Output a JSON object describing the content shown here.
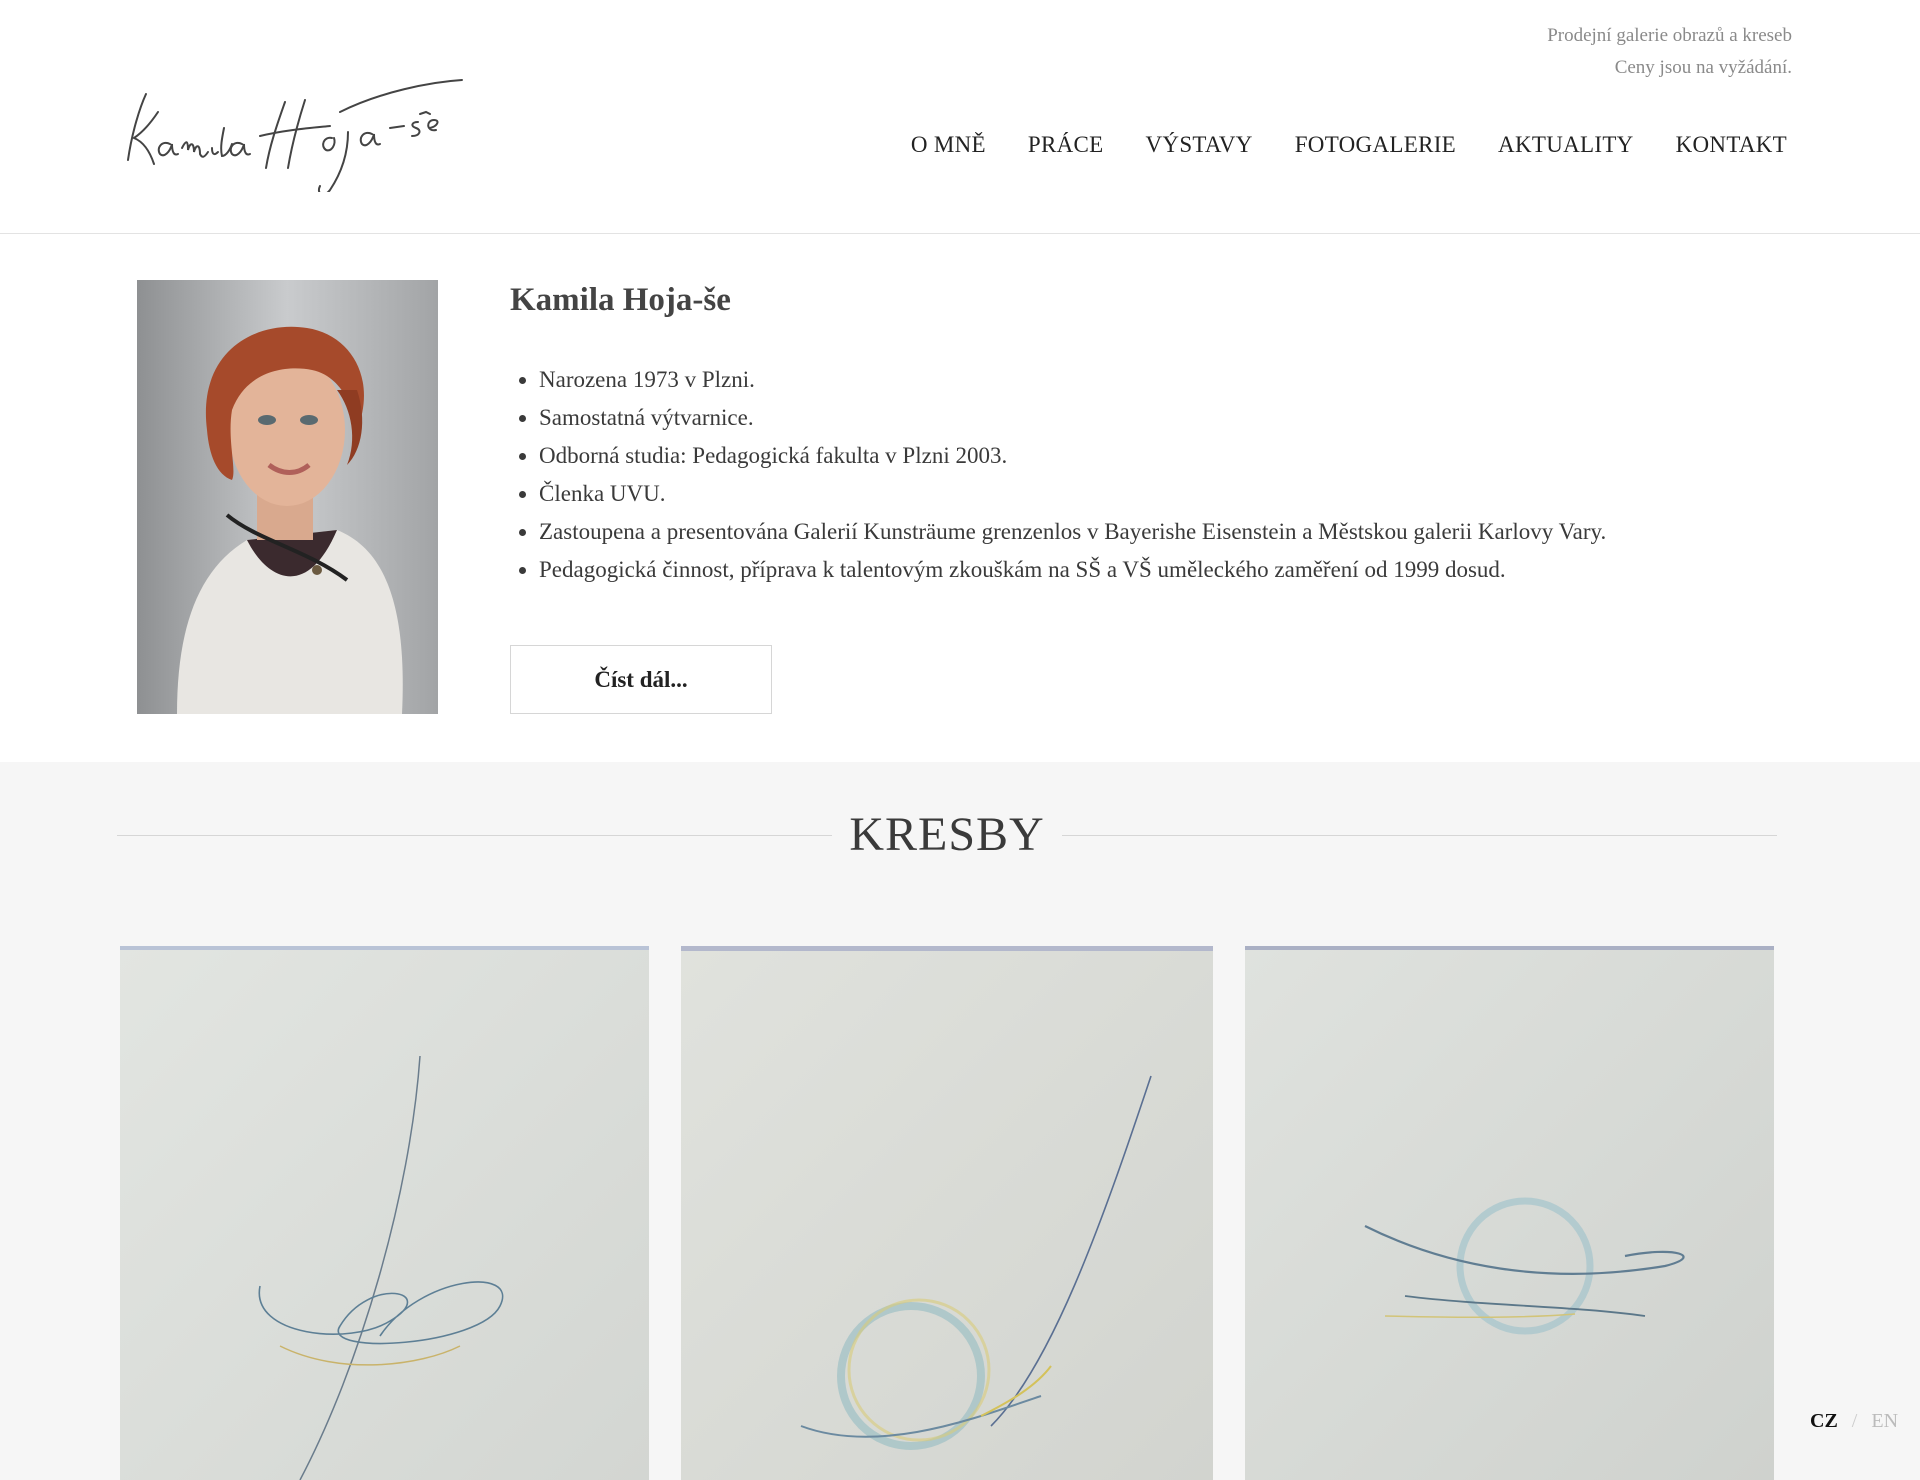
{
  "header": {
    "logo_text": "Kamila Hoja-še",
    "tagline_line1": "Prodejní galerie obrazů a kreseb",
    "tagline_line2": "Ceny jsou na vyžádání."
  },
  "nav": [
    "O MNĚ",
    "PRÁCE",
    "VÝSTAVY",
    "FOTOGALERIE",
    "AKTUALITY",
    "KONTAKT"
  ],
  "about": {
    "name": "Kamila Hoja-še",
    "bullets": [
      "Narozena 1973 v Plzni.",
      "Samostatná výtvarnice.",
      "Odborná studia: Pedagogická fakulta v Plzni 2003.",
      "Členka UVU.",
      "Zastoupena a presentována Galerií Kunsträume grenzenlos v Bayerishe Eisenstein a Městskou galerii Karlovy Vary.",
      "Pedagogická činnost, příprava k talentovým zkouškám na SŠ a VŠ uměleckého zaměření od 1999 dosud."
    ],
    "read_more": "Číst dál..."
  },
  "section": {
    "title": "KRESBY"
  },
  "lang": {
    "cz": "CZ",
    "separator": "/",
    "en": "EN"
  },
  "colors": {
    "accent_text": "#222222",
    "muted": "#8a8a8a",
    "section_bg": "#f6f6f6"
  }
}
